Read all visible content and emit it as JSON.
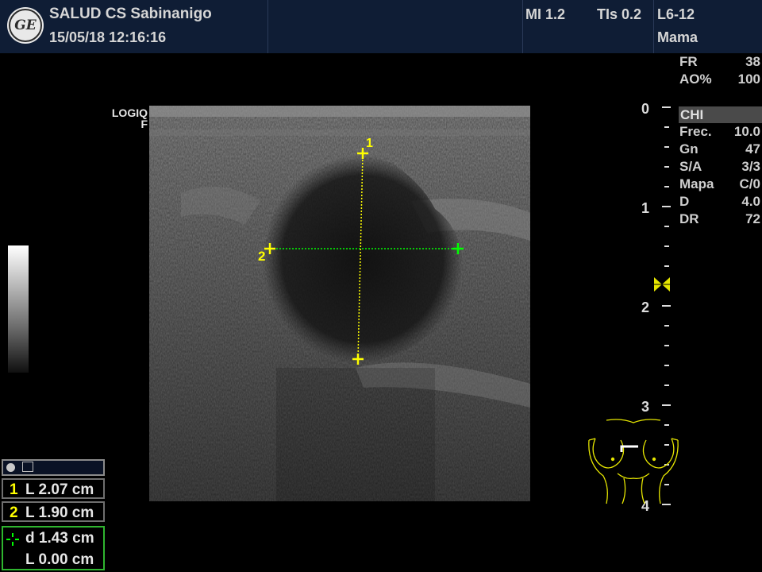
{
  "header": {
    "facility": "SALUD  CS Sabinanigo",
    "datetime": "15/05/18 12:16:16",
    "mi": "MI 1.2",
    "tis": "TIs 0.2",
    "probe": "L6-12",
    "preset": "Mama",
    "logo_text": "GE"
  },
  "params_top": [
    {
      "label": "FR",
      "value": "38"
    },
    {
      "label": "AO%",
      "value": "100"
    }
  ],
  "mode": "CHI",
  "params": [
    {
      "label": "Frec.",
      "value": "10.0"
    },
    {
      "label": "Gn",
      "value": "47"
    },
    {
      "label": "S/A",
      "value": "3/3"
    },
    {
      "label": "Mapa",
      "value": "C/0"
    },
    {
      "label": "D",
      "value": "4.0"
    },
    {
      "label": "DR",
      "value": "72"
    }
  ],
  "brand": {
    "line1": "LOGIQ",
    "line2": "F"
  },
  "depth_scale": [
    "0",
    "1",
    "2",
    "3",
    "4"
  ],
  "calipers": {
    "vertical": "1",
    "horizontal": "2"
  },
  "measurements": [
    {
      "num": "1",
      "label": "L",
      "value": "2.07 cm"
    },
    {
      "num": "2",
      "label": "L",
      "value": "1.90 cm"
    }
  ],
  "active_measure": [
    {
      "label": "d",
      "value": "1.43 cm"
    },
    {
      "label": "L",
      "value": "0.00 cm"
    }
  ],
  "colors": {
    "header_bg": "#0f1d35",
    "caliper": "#ffff00",
    "active_caliper": "#00ff00",
    "body_mark": "#e6e600"
  },
  "icons": [
    "ge-logo-icon",
    "focus-marker-icon",
    "body-mark-breast-icon",
    "toolbox-icon"
  ]
}
